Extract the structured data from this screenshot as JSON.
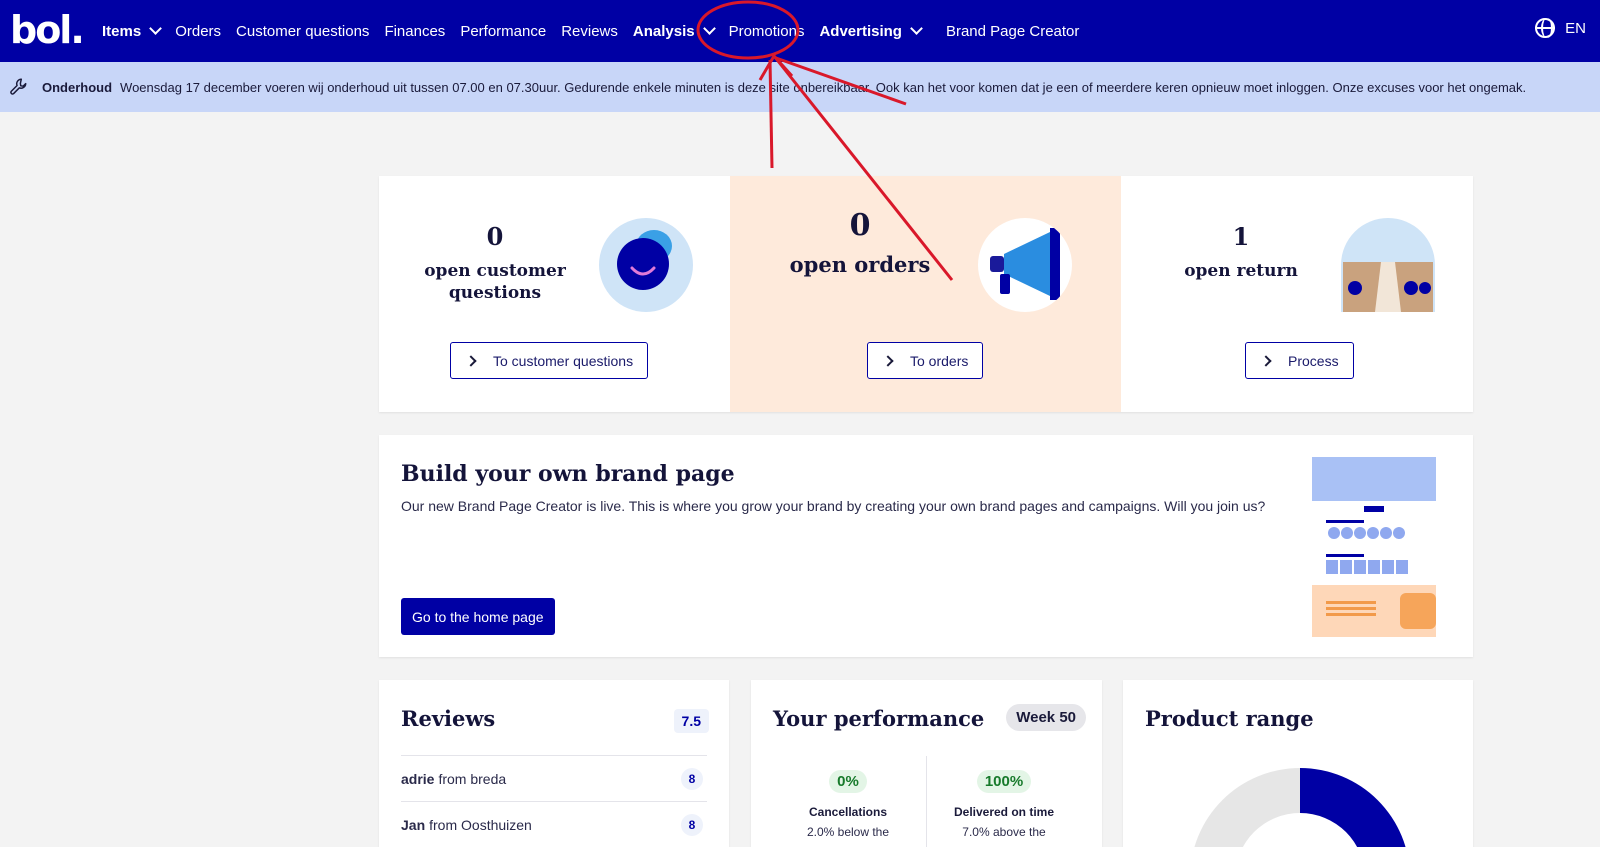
{
  "nav": {
    "logo": "bol.",
    "items": [
      {
        "label": "Items",
        "bold": true,
        "dropdown": true
      },
      {
        "label": "Orders"
      },
      {
        "label": "Customer questions"
      },
      {
        "label": "Finances"
      },
      {
        "label": "Performance"
      },
      {
        "label": "Reviews"
      },
      {
        "label": "Analysis",
        "bold": true,
        "dropdown": true
      },
      {
        "label": "Promotions"
      },
      {
        "label": "Advertising",
        "bold": true,
        "dropdown": true
      },
      {
        "label": "Brand Page Creator"
      }
    ],
    "language": "EN"
  },
  "banner": {
    "title": "Onderhoud",
    "message": "Woensdag 17 december voeren wij onderhoud uit tussen 07.00 en 07.30uur. Gedurende enkele minuten is deze site onbereikbaar. Ook kan het voor komen dat je een of meerdere keren opnieuw moet inloggen. Onze excuses voor het ongemak."
  },
  "stats": [
    {
      "count": "0",
      "label": "open customer questions",
      "button": "To customer questions"
    },
    {
      "count": "0",
      "label": "open orders",
      "button": "To orders"
    },
    {
      "count": "1",
      "label": "open return",
      "button": "Process"
    }
  ],
  "brand_page": {
    "title": "Build your own brand page",
    "description": "Our new Brand Page Creator is live. This is where you grow your brand by creating your own brand pages and campaigns. Will you join us?",
    "button": "Go to the home page"
  },
  "reviews": {
    "title": "Reviews",
    "score": "7.5",
    "rows": [
      {
        "name": "adrie",
        "from": "from breda",
        "score": "8"
      },
      {
        "name": "Jan",
        "from": "from Oosthuizen",
        "score": "8"
      }
    ]
  },
  "performance": {
    "title": "Your performance",
    "week": "Week 50",
    "metrics": [
      {
        "pct": "0%",
        "label": "Cancellations",
        "sub": "2.0% below the"
      },
      {
        "pct": "100%",
        "label": "Delivered on time",
        "sub": "7.0% above the"
      }
    ]
  },
  "product_range": {
    "title": "Product range"
  },
  "colors": {
    "brand_blue": "#0000a4",
    "banner_bg": "#c8d6f8",
    "annotation_red": "#d9182a",
    "orders_bg": "#feeadb"
  }
}
